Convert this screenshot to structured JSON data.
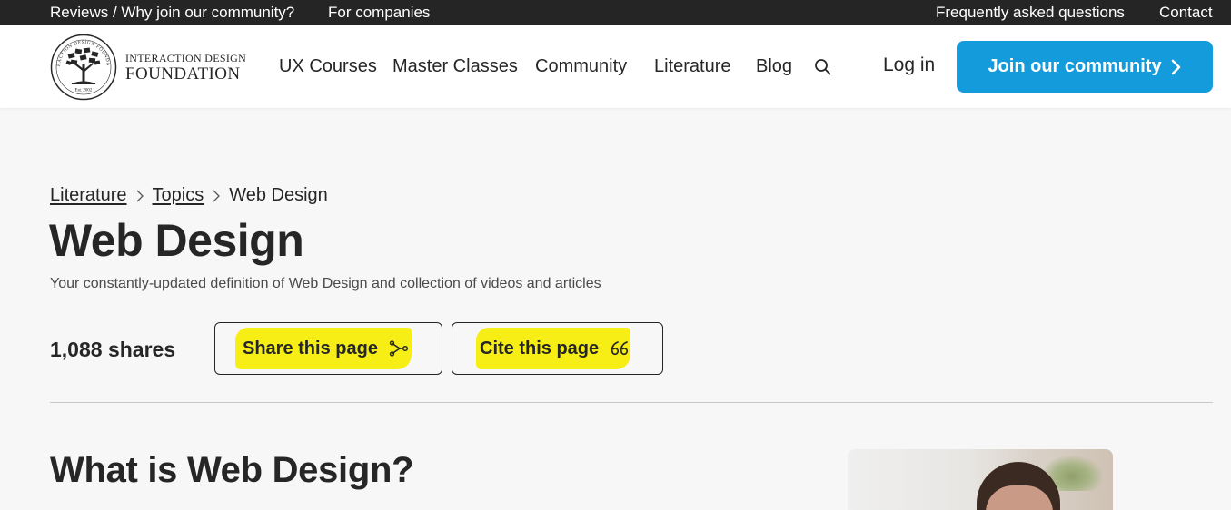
{
  "topbar": {
    "left_links": [
      "Reviews / Why join our community?",
      "For companies"
    ],
    "right_links": [
      "Frequently asked questions",
      "Contact"
    ]
  },
  "header": {
    "logo": {
      "line1": "INTERACTION DESIGN",
      "line2": "FOUNDATION",
      "seal_text": "INTERACTION DESIGN FOUNDATION",
      "seal_est": "Est. 2002"
    },
    "nav": [
      "UX Courses",
      "Master Classes",
      "Community",
      "Literature",
      "Blog"
    ],
    "search_icon": "search-icon",
    "login_label": "Log in",
    "join_label": "Join our community",
    "accent_color": "#139bdc"
  },
  "breadcrumb": {
    "items": [
      "Literature",
      "Topics"
    ],
    "current": "Web Design"
  },
  "page": {
    "title": "Web Design",
    "subtitle": "Your constantly-updated definition of Web Design and collection of videos and articles",
    "shares": "1,088 shares",
    "share_label": "Share this page",
    "cite_label": "Cite this page",
    "highlight_color": "#f7ee16",
    "section_title": "What is Web Design?"
  }
}
